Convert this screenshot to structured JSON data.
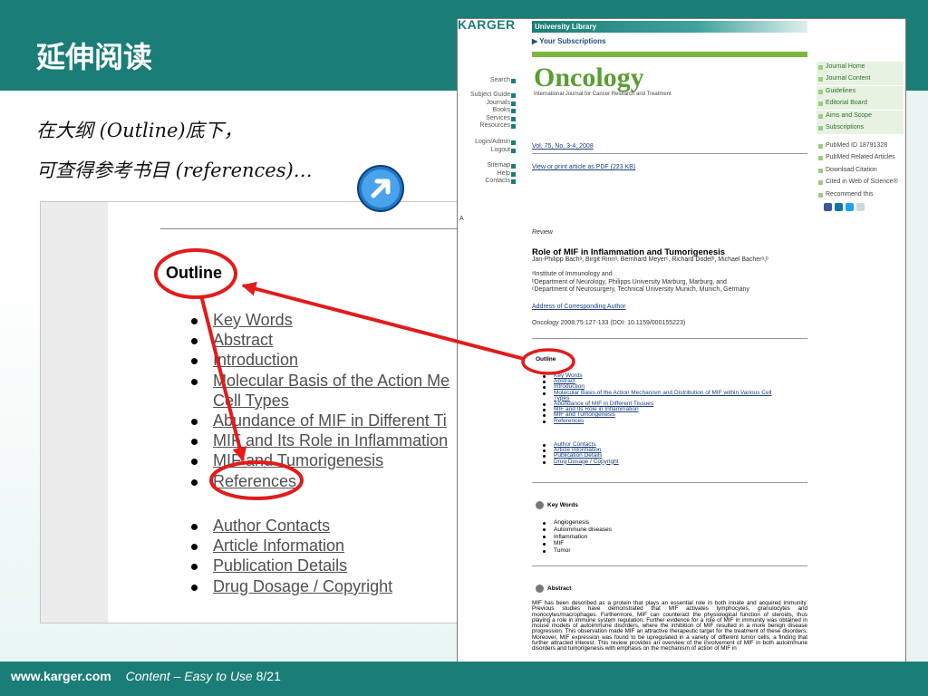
{
  "slide": {
    "title": "延伸阅读",
    "intro_line1": "在大纲 (Outline)底下，",
    "intro_line2": "可查得参考书目 (references)…",
    "footer_url": "www.karger.com",
    "footer_caption": "Content – Easy to Use",
    "page_number": "8/21",
    "accent_color": "#1b7d77",
    "highlight_color": "#e21b1b"
  },
  "zoom_panel": {
    "heading": "Outline",
    "items1": [
      "Key Words",
      "Abstract",
      "Introduction",
      "Molecular Basis of the Action Me",
      "Cell Types",
      "Abundance of MIF in Different Ti",
      "MIF and Its Role in Inflammation",
      "MIF and Tumorigenesis",
      "References"
    ],
    "items2": [
      "Author Contacts",
      "Article Information",
      "Publication Details",
      "Drug Dosage / Copyright"
    ]
  },
  "screenshot": {
    "publisher_logo": "KARGER",
    "university_bar": "University Library",
    "your_subscriptions": "Your Subscriptions",
    "journal_title": "Oncology",
    "journal_subtitle": "International Journal for Cancer Research and Treatment",
    "left_nav1": [
      "Search"
    ],
    "left_nav2": [
      "Subject Guide",
      "Journals",
      "Books",
      "Services",
      "Resources"
    ],
    "left_nav3": [
      "Login/Admin",
      "Logout"
    ],
    "left_nav4": [
      "Sitemap",
      "Help",
      "Contacts"
    ],
    "right_nav1": [
      "Journal Home",
      "Journal Content",
      "Guidelines",
      "Editorial Board",
      "Aims and Scope",
      "Subscriptions"
    ],
    "right_nav2": [
      "PubMed ID 18791328",
      "PubMed Related Articles",
      "Download Citation",
      "Cited in Web of Science®",
      "Recommend this"
    ],
    "volume": "Vol. 75, No. 3-4, 2008",
    "pdf_link": "View or print article as PDF (223 KB)",
    "glyph_a": "A",
    "article_type": "Review",
    "article_title": "Role of MIF in Inflammation and Tumorigenesis",
    "authors": "Jan-Philipp Bachᵃ, Birgit Rinnᵃ, Bernhard Meyerᶜ, Richard Dodelᵇ, Michael Bacherᵃ,ᵇ",
    "institutes": [
      "ᵃInstitute of Immunology and",
      "ᵇDepartment of Neurology, Philipps University Marburg, Marburg, and",
      "ᶜDepartment of Neurosurgery, Technical University Munich, Munich, Germany"
    ],
    "address_link": "Address of Corresponding Author",
    "citation": "Oncology 2008;75:127-133 (DOI: 10.1159/000155223)",
    "outline_heading": "Outline",
    "outline_items1": [
      "Key Words",
      "Abstract",
      "Introduction",
      "Molecular Basis of the Action Mechanism and Distribution of MIF within Various Cell",
      "Types",
      "Abundance of MIF in Different Tissues",
      "MIF and Its Role in Inflammation",
      "MIF and Tumorigenesis",
      "References"
    ],
    "outline_items2": [
      "Author Contacts",
      "Article Information",
      "Publication Details",
      "Drug Dosage / Copyright"
    ],
    "keywords_heading": "Key Words",
    "keywords": [
      "Angiogenesis",
      "Autoimmune diseases",
      "Inflammation",
      "MIF",
      "Tumor"
    ],
    "abstract_heading": "Abstract",
    "abstract_text": "MIF has been described as a protein that plays an essential role in both innate and acquired immunity. Previous studies have demonstrated that MIF activates lymphocytes, granulocytes and monocytes/macrophages. Furthermore, MIF can counteract the physiological function of steroids, thus playing a role in immune system regulation. Further evidence for a role of MIF in immunity was obtained in mouse models of autoimmune disorders, where the inhibition of MIF resulted in a more benign disease progression. This observation made MIF an attractive therapeutic target for the treatment of these disorders. Moreover, MIF expression was found to be upregulated in a variety of different tumor cells, a finding that further attracted interest. This review provides an overview of the involvement of MIF in both autoimmune disorders and tumorigenesis with emphasis on the mechanism of action of MIF in"
  }
}
